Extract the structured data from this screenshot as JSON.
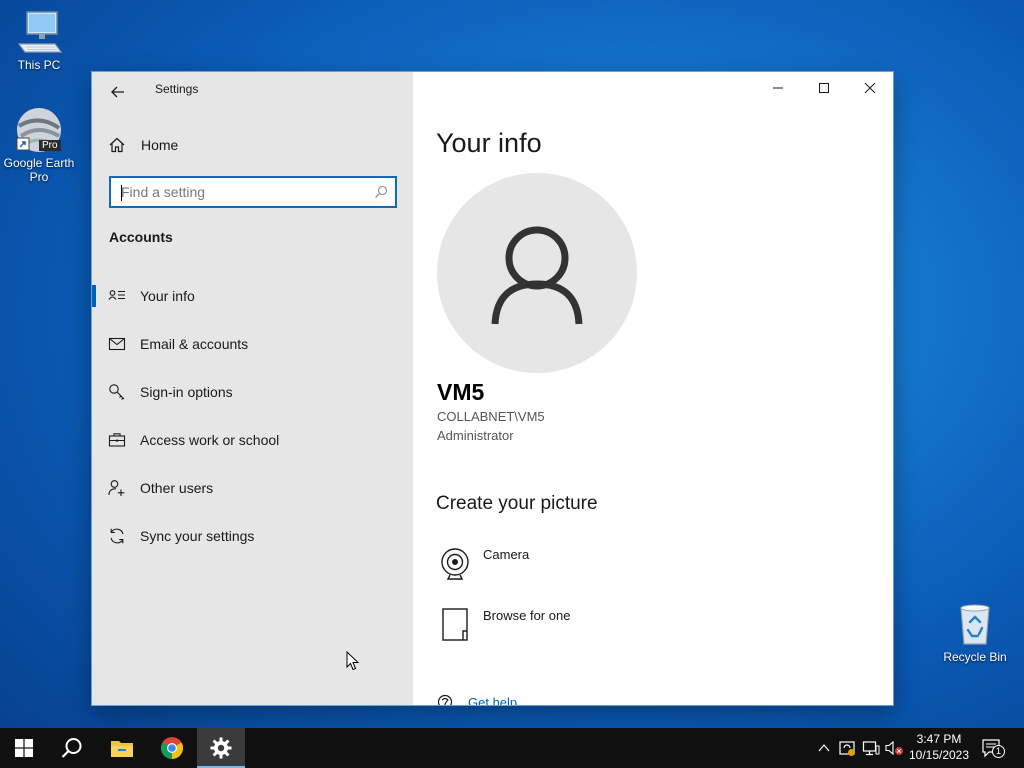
{
  "desktop": {
    "icons": [
      {
        "label": "This PC"
      },
      {
        "label": "Google Earth Pro"
      },
      {
        "label": "Recycle Bin"
      }
    ],
    "gearth_badge": "Pro"
  },
  "window": {
    "title": "Settings",
    "controls": {
      "minimize": "minimize-icon",
      "maximize": "maximize-icon",
      "close": "close-icon"
    }
  },
  "sidebar": {
    "home_label": "Home",
    "search_placeholder": "Find a setting",
    "section_title": "Accounts",
    "items": [
      {
        "label": "Your info",
        "icon": "your-info-icon",
        "active": true
      },
      {
        "label": "Email & accounts",
        "icon": "mail-icon"
      },
      {
        "label": "Sign-in options",
        "icon": "key-icon"
      },
      {
        "label": "Access work or school",
        "icon": "briefcase-icon"
      },
      {
        "label": "Other users",
        "icon": "add-user-icon"
      },
      {
        "label": "Sync your settings",
        "icon": "sync-icon"
      }
    ]
  },
  "main": {
    "title": "Your info",
    "user": {
      "name": "VM5",
      "domain": "COLLABNET\\VM5",
      "role": "Administrator"
    },
    "create_picture": {
      "title": "Create your picture",
      "options": [
        {
          "label": "Camera",
          "icon": "camera-icon"
        },
        {
          "label": "Browse for one",
          "icon": "browse-icon"
        }
      ]
    },
    "help_label": "Get help"
  },
  "taskbar": {
    "clock_time": "3:47 PM",
    "clock_date": "10/15/2023",
    "notification_count": "1"
  },
  "colors": {
    "accent": "#0063b1",
    "sidebar_bg": "#e6e6e6",
    "taskbar_bg": "#101010"
  }
}
